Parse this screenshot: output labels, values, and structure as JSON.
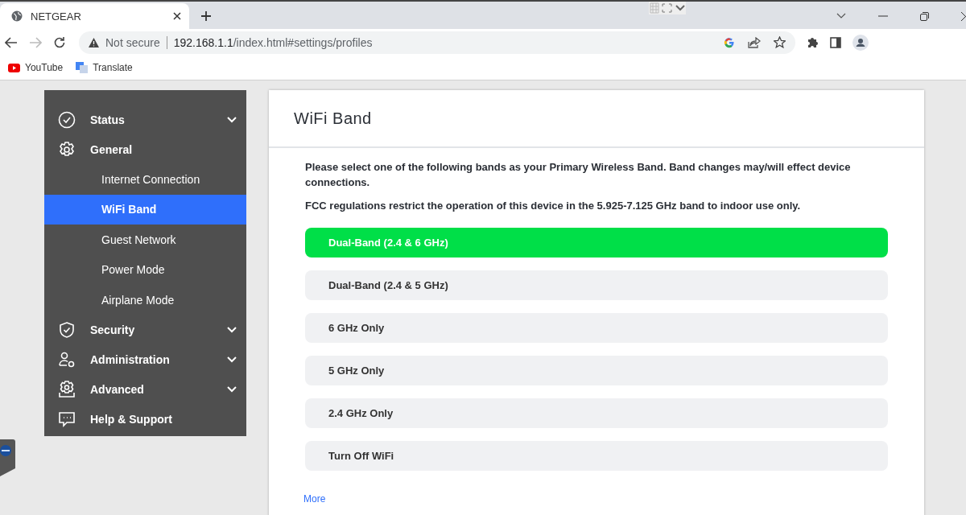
{
  "browser": {
    "tab": {
      "title": "NETGEAR"
    },
    "address": {
      "security": "Not secure",
      "host": "192.168.1.1",
      "path": "/index.html#settings/profiles"
    },
    "bookmarks": [
      "YouTube",
      "Translate"
    ]
  },
  "sidebar": {
    "items": [
      {
        "label": "Status",
        "expanded": false
      },
      {
        "label": "General",
        "expanded": true,
        "children": [
          {
            "label": "Internet Connection",
            "selected": false
          },
          {
            "label": "WiFi Band",
            "selected": true
          },
          {
            "label": "Guest Network",
            "selected": false
          },
          {
            "label": "Power Mode",
            "selected": false
          },
          {
            "label": "Airplane Mode",
            "selected": false
          }
        ]
      },
      {
        "label": "Security",
        "expanded": false
      },
      {
        "label": "Administration",
        "expanded": false
      },
      {
        "label": "Advanced",
        "expanded": false
      },
      {
        "label": "Help & Support"
      }
    ]
  },
  "content": {
    "title": "WiFi Band",
    "paragraphs": [
      "Please select one of the following bands as your Primary Wireless Band. Band changes may/will effect device connections.",
      "FCC regulations restrict the operation of this device in the 5.925-7.125 GHz band to indoor use only."
    ],
    "options": [
      {
        "label": "Dual-Band (2.4 & 6 GHz)",
        "selected": true
      },
      {
        "label": "Dual-Band (2.4 & 5 GHz)",
        "selected": false
      },
      {
        "label": "6 GHz Only",
        "selected": false
      },
      {
        "label": "5 GHz Only",
        "selected": false
      },
      {
        "label": "2.4 GHz Only",
        "selected": false
      },
      {
        "label": "Turn Off WiFi",
        "selected": false
      }
    ],
    "more_link": "More"
  }
}
